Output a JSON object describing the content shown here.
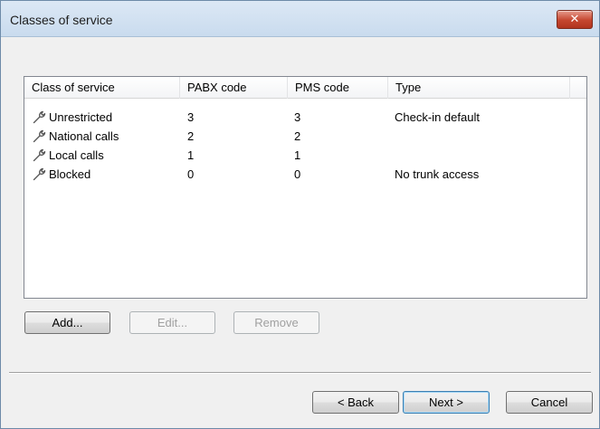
{
  "window": {
    "title": "Classes of service",
    "close_label": "✕"
  },
  "table": {
    "columns": [
      "Class of service",
      "PABX code",
      "PMS code",
      "Type"
    ],
    "rows": [
      {
        "name": "Unrestricted",
        "pabx": "3",
        "pms": "3",
        "type": "Check-in default"
      },
      {
        "name": "National calls",
        "pabx": "2",
        "pms": "2",
        "type": ""
      },
      {
        "name": "Local calls",
        "pabx": "1",
        "pms": "1",
        "type": ""
      },
      {
        "name": "Blocked",
        "pabx": "0",
        "pms": "0",
        "type": "No trunk access"
      }
    ],
    "row_icon": "wrench-icon"
  },
  "actions": {
    "add": "Add...",
    "edit": "Edit...",
    "remove": "Remove"
  },
  "nav": {
    "back": "< Back",
    "next": "Next >",
    "cancel": "Cancel"
  }
}
